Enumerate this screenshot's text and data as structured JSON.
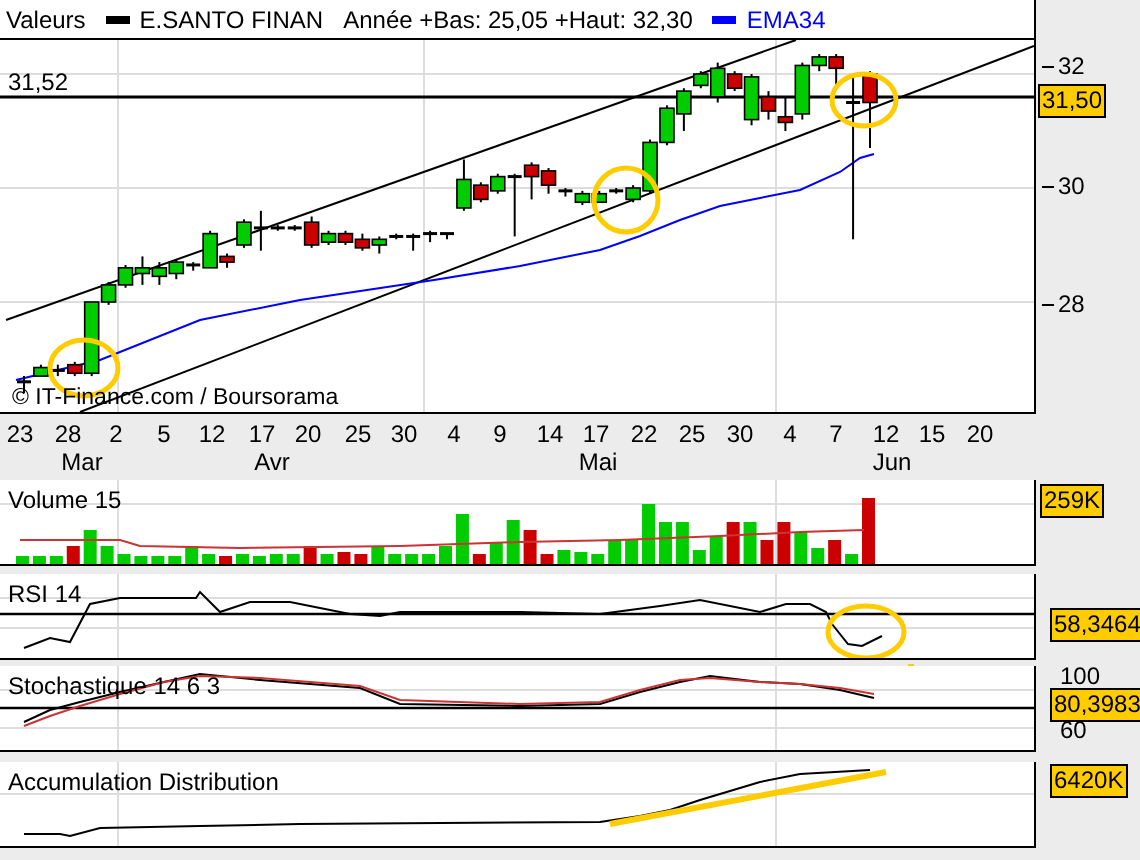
{
  "header": [
    {
      "kind": "text",
      "text": "Valeurs"
    },
    {
      "kind": "legend",
      "text": "E.SANTO FINAN",
      "color": "#000000"
    },
    {
      "kind": "text",
      "text": "Année +Bas: 25,05 +Haut: 32,30"
    },
    {
      "kind": "legend",
      "text": "EMA34",
      "color": "#0000ff"
    }
  ],
  "price_panel": {
    "reference_label": "31,52",
    "y_axis": [
      "32",
      "30",
      "28"
    ],
    "last_value": "31,50",
    "credit": "© IT-Finance.com / Boursorama"
  },
  "x_axis": {
    "days": [
      "23",
      "28",
      "2",
      "5",
      "12",
      "17",
      "20",
      "25",
      "30",
      "4",
      "9",
      "14",
      "17",
      "22",
      "25",
      "30",
      "4",
      "7",
      "12",
      "15",
      "20"
    ],
    "months": [
      "Mar",
      "Avr",
      "Mai",
      "Jun"
    ]
  },
  "indicators": [
    {
      "kind": "volume",
      "title": "Volume 15",
      "value": "259K"
    },
    {
      "kind": "rsi",
      "title": "RSI 14",
      "value": "58,3464"
    },
    {
      "kind": "stochastic",
      "title": "Stochastique 14 6 3",
      "value": "80,3983",
      "axis": [
        "100",
        "60"
      ]
    },
    {
      "kind": "accumulation",
      "title": "Accumulation Distribution",
      "value": "6420K"
    }
  ]
}
